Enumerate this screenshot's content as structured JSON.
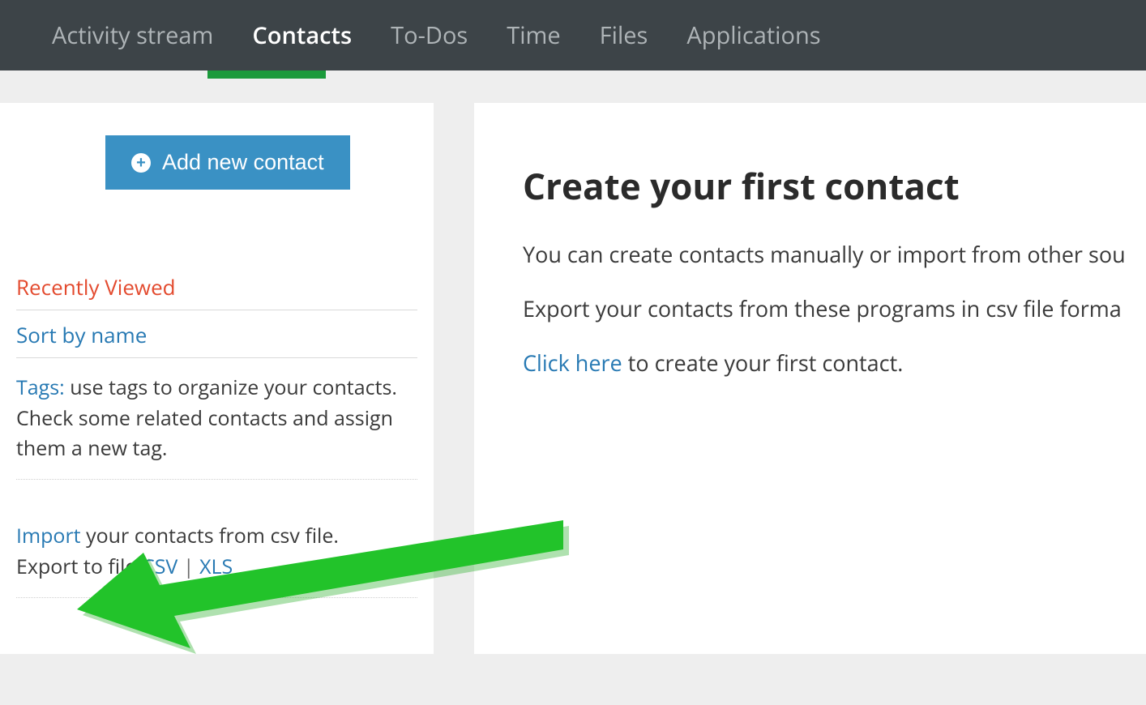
{
  "nav": {
    "items": [
      {
        "label": "Activity stream"
      },
      {
        "label": "Contacts"
      },
      {
        "label": "To-Dos"
      },
      {
        "label": "Time"
      },
      {
        "label": "Files"
      },
      {
        "label": "Applications"
      }
    ]
  },
  "sidebar": {
    "add_button_label": "Add new contact",
    "recently_viewed": "Recently Viewed",
    "sort_by_name": "Sort by name",
    "tags_label": "Tags:",
    "tags_text": " use tags to organize your contacts. Check some related contacts and assign them a new tag.",
    "import_link": "Import",
    "import_text": " your contacts from csv file.",
    "export_prefix": "Export to file ",
    "csv_link": "CSV",
    "separator": " | ",
    "xls_link": "XLS"
  },
  "main": {
    "title": "Create your first contact",
    "para1": "You can create contacts manually or import from other sou",
    "para2": "Export your contacts from these programs in csv file forma",
    "click_here": "Click here",
    "para3_suffix": " to create your first contact."
  }
}
